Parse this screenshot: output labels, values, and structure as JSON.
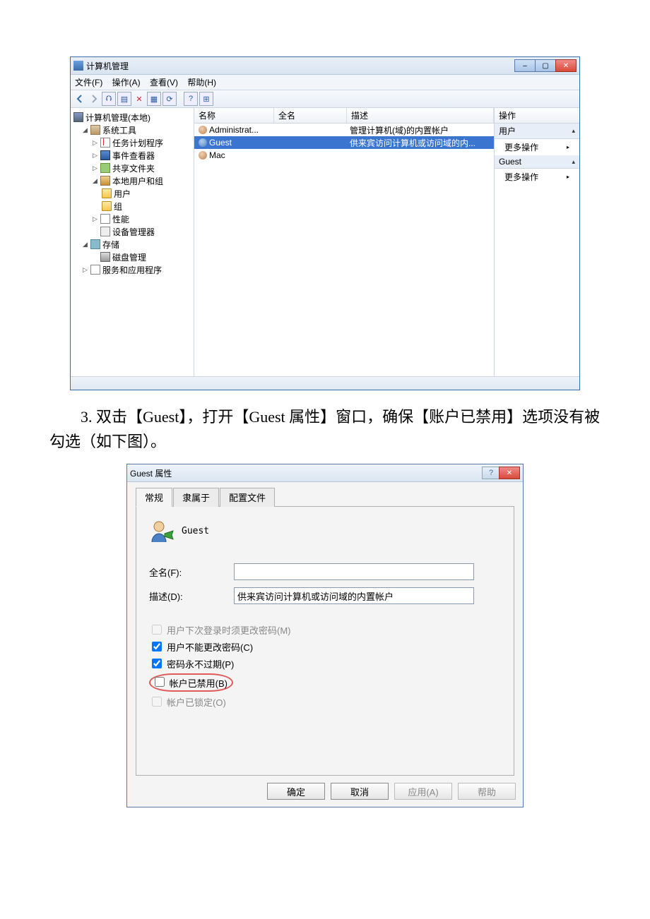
{
  "mmc": {
    "title": "计算机管理",
    "menu": {
      "file": "文件(F)",
      "action": "操作(A)",
      "view": "查看(V)",
      "help": "帮助(H)"
    },
    "tree": {
      "root": "计算机管理(本地)",
      "systools": "系统工具",
      "sched": "任务计划程序",
      "event": "事件查看器",
      "share": "共享文件夹",
      "lusers": "本地用户和组",
      "users": "用户",
      "groups": "组",
      "perf": "性能",
      "dev": "设备管理器",
      "storage": "存储",
      "disk": "磁盘管理",
      "svc": "服务和应用程序"
    },
    "list": {
      "hname": "名称",
      "hfull": "全名",
      "hdesc": "描述",
      "rows": [
        {
          "name": "Administrat...",
          "full": "",
          "desc": "管理计算机(域)的内置帐户"
        },
        {
          "name": "Guest",
          "full": "",
          "desc": "供来宾访问计算机或访问域的内...",
          "sel": true
        },
        {
          "name": "Mac",
          "full": "",
          "desc": ""
        }
      ]
    },
    "actions": {
      "head": "操作",
      "sec1": "用户",
      "more": "更多操作",
      "sec2": "Guest"
    }
  },
  "body": {
    "step3": "3. 双击【Guest】，打开【Guest 属性】窗口，确保【账户已禁用】选项没有被勾选（如下图）。"
  },
  "dlg": {
    "title": "Guest 属性",
    "tabs": {
      "general": "常规",
      "member": "隶属于",
      "profile": "配置文件"
    },
    "guest": "Guest",
    "fullname_lbl": "全名(F):",
    "fullname_val": "",
    "desc_lbl": "描述(D):",
    "desc_val": "供来宾访问计算机或访问域的内置帐户",
    "chk_mustchg": "用户下次登录时须更改密码(M)",
    "chk_cantchg": "用户不能更改密码(C)",
    "chk_noexp": "密码永不过期(P)",
    "chk_disabled": "帐户已禁用(B)",
    "chk_locked": "帐户已锁定(O)",
    "btn_ok": "确定",
    "btn_cancel": "取消",
    "btn_apply": "应用(A)",
    "btn_help": "帮助"
  }
}
